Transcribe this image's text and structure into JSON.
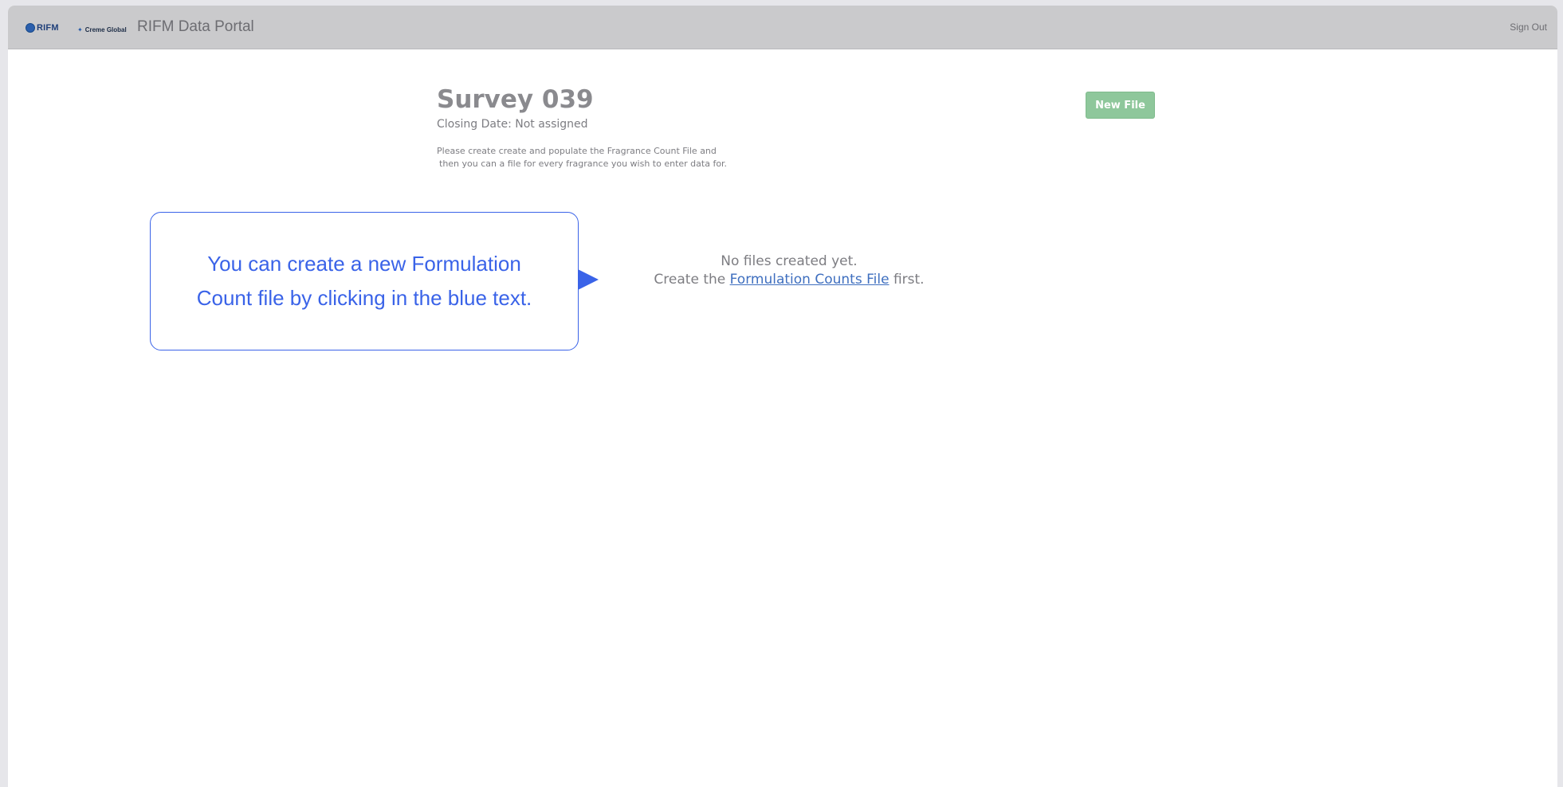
{
  "header": {
    "rifm_logo_text": "RIFM",
    "creme_logo_text": "Creme Global",
    "app_title": "RIFM Data Portal",
    "sign_out": "Sign Out"
  },
  "survey": {
    "title": "Survey 039",
    "closing_date": "Closing Date: Not assigned",
    "instructions_line1": "Please create create and populate the Fragrance Count File and",
    "instructions_line2": "then you can a file for every fragrance you wish to enter data for.",
    "new_file_label": "New File"
  },
  "empty_state": {
    "line1": "No files created yet.",
    "line2_prefix": "Create the",
    "link_text": "Formulation Counts File",
    "line2_suffix": "first."
  },
  "callout": {
    "text": "You can create a new Formulation\nCount file  by clicking in the blue text."
  },
  "colors": {
    "topbar": "#cacacc",
    "new_file_button": "#8ec79b",
    "callout_accent": "#3a63e8",
    "link": "#3f6fbf"
  }
}
